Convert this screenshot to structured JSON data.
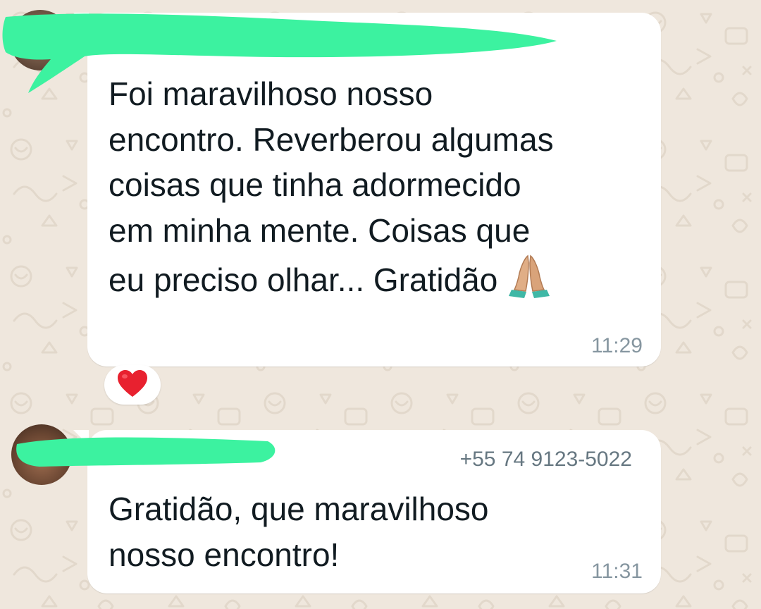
{
  "conversation": {
    "messages": [
      {
        "text": "Foi maravilhoso nosso\nencontro. Reverberou algumas\ncoisas que tinha adormecido\nem minha mente. Coisas que\neu preciso olhar... Gratidão",
        "trailing_emoji": "folded-hands-icon",
        "time": "11:29",
        "reaction": "red-heart-icon"
      },
      {
        "sender_phone": "+55 74 9123-5022",
        "text": "Gratidão, que maravilhoso\nnosso encontro!",
        "time": "11:31"
      }
    ]
  },
  "colors": {
    "wallpaper": "#efe7dd",
    "bubble": "#ffffff",
    "text": "#111b21",
    "time": "#8696a0",
    "redaction": "#3cf2a0",
    "heart": "#e8212f"
  }
}
